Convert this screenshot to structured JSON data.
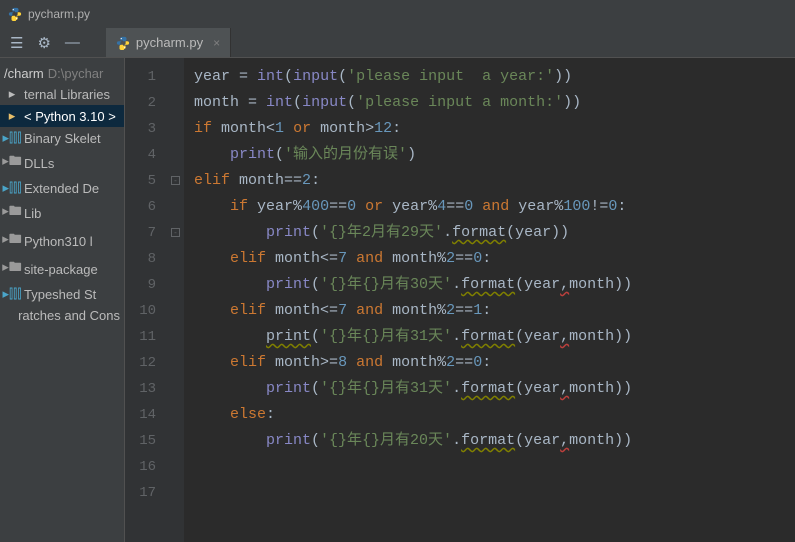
{
  "window": {
    "title": "pycharm.py"
  },
  "tab": {
    "name": "pycharm.py"
  },
  "breadcrumb": {
    "project": "/charm",
    "path": "D:\\pychar"
  },
  "sidebar": {
    "items": [
      {
        "label": "ternal Libraries",
        "icon": "lib"
      },
      {
        "label": "< Python 3.10 >",
        "icon": "py"
      },
      {
        "label": "Binary Skelet",
        "icon": "bars"
      },
      {
        "label": "DLLs",
        "icon": "folder"
      },
      {
        "label": "Extended De",
        "icon": "bars"
      },
      {
        "label": "Lib",
        "icon": "folder"
      },
      {
        "label": "Python310 l",
        "icon": "folder"
      },
      {
        "label": "site-package",
        "icon": "folder"
      },
      {
        "label": "Typeshed St",
        "icon": "bars"
      },
      {
        "label": "ratches and Cons",
        "icon": "none"
      }
    ]
  },
  "code": {
    "line_count": 17,
    "tokens": [
      [
        [
          "id",
          "year "
        ],
        [
          "op",
          "= "
        ],
        [
          "bi",
          "int"
        ],
        [
          "op",
          "("
        ],
        [
          "bi",
          "input"
        ],
        [
          "op",
          "("
        ],
        [
          "str",
          "'please input  a year:'"
        ],
        [
          "op",
          "))"
        ]
      ],
      [
        [
          "id",
          "month "
        ],
        [
          "op",
          "= "
        ],
        [
          "bi",
          "int"
        ],
        [
          "op",
          "("
        ],
        [
          "bi",
          "input"
        ],
        [
          "op",
          "("
        ],
        [
          "str",
          "'please input a month:'"
        ],
        [
          "op",
          "))"
        ]
      ],
      [
        [
          "kw",
          "if "
        ],
        [
          "id",
          "month"
        ],
        [
          "op",
          "<"
        ],
        [
          "num",
          "1"
        ],
        [
          "op",
          " "
        ],
        [
          "kw",
          "or"
        ],
        [
          "op",
          " "
        ],
        [
          "id",
          "month"
        ],
        [
          "op",
          ">"
        ],
        [
          "num",
          "12"
        ],
        [
          "op",
          ":"
        ]
      ],
      [
        [
          "op",
          "    "
        ],
        [
          "fn",
          "print"
        ],
        [
          "op",
          "("
        ],
        [
          "str",
          "'输入的月份有误'"
        ],
        [
          "op",
          ")"
        ]
      ],
      [
        [
          "kw",
          "elif "
        ],
        [
          "id",
          "month"
        ],
        [
          "op",
          "=="
        ],
        [
          "num",
          "2"
        ],
        [
          "op",
          ":"
        ]
      ],
      [
        [
          "op",
          "    "
        ],
        [
          "kw",
          "if "
        ],
        [
          "id",
          "year"
        ],
        [
          "op",
          "%"
        ],
        [
          "num",
          "400"
        ],
        [
          "op",
          "=="
        ],
        [
          "num",
          "0"
        ],
        [
          "op",
          " "
        ],
        [
          "kw",
          "or"
        ],
        [
          "op",
          " "
        ],
        [
          "id",
          "year"
        ],
        [
          "op",
          "%"
        ],
        [
          "num",
          "4"
        ],
        [
          "op",
          "=="
        ],
        [
          "num",
          "0"
        ],
        [
          "op",
          " "
        ],
        [
          "kw",
          "and"
        ],
        [
          "op",
          " "
        ],
        [
          "id",
          "year"
        ],
        [
          "op",
          "%"
        ],
        [
          "num",
          "100"
        ],
        [
          "op",
          "!="
        ],
        [
          "num",
          "0"
        ],
        [
          "op",
          ":"
        ]
      ],
      [
        [
          "op",
          "        "
        ],
        [
          "fn",
          "print"
        ],
        [
          "op",
          "("
        ],
        [
          "str",
          "'{}年2月有29天'"
        ],
        [
          "op",
          "."
        ],
        [
          "id warn",
          "format"
        ],
        [
          "op",
          "(year))"
        ]
      ],
      [
        [
          "op",
          "    "
        ],
        [
          "kw",
          "elif "
        ],
        [
          "id",
          "month"
        ],
        [
          "op",
          "<="
        ],
        [
          "num",
          "7"
        ],
        [
          "op",
          " "
        ],
        [
          "kw",
          "and"
        ],
        [
          "op",
          " "
        ],
        [
          "id",
          "month"
        ],
        [
          "op",
          "%"
        ],
        [
          "num",
          "2"
        ],
        [
          "op",
          "=="
        ],
        [
          "num",
          "0"
        ],
        [
          "op",
          ":"
        ]
      ],
      [
        [
          "op",
          "        "
        ],
        [
          "fn",
          "print"
        ],
        [
          "op",
          "("
        ],
        [
          "str",
          "'{}年{}月有30天'"
        ],
        [
          "op",
          "."
        ],
        [
          "id warn",
          "format"
        ],
        [
          "op",
          "(year"
        ],
        [
          "err",
          ","
        ],
        [
          "op",
          "month))"
        ]
      ],
      [
        [
          "op",
          "    "
        ],
        [
          "kw",
          "elif "
        ],
        [
          "id",
          "month"
        ],
        [
          "op",
          "<="
        ],
        [
          "num",
          "7"
        ],
        [
          "op",
          " "
        ],
        [
          "kw",
          "and"
        ],
        [
          "op",
          " "
        ],
        [
          "id",
          "month"
        ],
        [
          "op",
          "%"
        ],
        [
          "num",
          "2"
        ],
        [
          "op",
          "=="
        ],
        [
          "num",
          "1"
        ],
        [
          "op",
          ":"
        ]
      ],
      [
        [
          "op",
          "        "
        ],
        [
          "warn",
          "print"
        ],
        [
          "op",
          "("
        ],
        [
          "str",
          "'{}年{}月有31天'"
        ],
        [
          "op",
          "."
        ],
        [
          "id warn",
          "format"
        ],
        [
          "op",
          "(year"
        ],
        [
          "err",
          ","
        ],
        [
          "op",
          "month))"
        ]
      ],
      [
        [
          "op",
          "    "
        ],
        [
          "kw",
          "elif "
        ],
        [
          "id",
          "month"
        ],
        [
          "op",
          ">="
        ],
        [
          "num",
          "8"
        ],
        [
          "op",
          " "
        ],
        [
          "kw",
          "and"
        ],
        [
          "op",
          " "
        ],
        [
          "id",
          "month"
        ],
        [
          "op",
          "%"
        ],
        [
          "num",
          "2"
        ],
        [
          "op",
          "=="
        ],
        [
          "num",
          "0"
        ],
        [
          "op",
          ":"
        ]
      ],
      [
        [
          "op",
          "        "
        ],
        [
          "fn",
          "print"
        ],
        [
          "op",
          "("
        ],
        [
          "str",
          "'{}年{}月有31天'"
        ],
        [
          "op",
          "."
        ],
        [
          "id warn",
          "format"
        ],
        [
          "op",
          "(year"
        ],
        [
          "err",
          ","
        ],
        [
          "op",
          "month))"
        ]
      ],
      [
        [
          "op",
          "    "
        ],
        [
          "kw",
          "else"
        ],
        [
          "op",
          ":"
        ]
      ],
      [
        [
          "op",
          "        "
        ],
        [
          "fn",
          "print"
        ],
        [
          "op",
          "("
        ],
        [
          "str",
          "'{}年{}月有20天'"
        ],
        [
          "op",
          "."
        ],
        [
          "id warn",
          "format"
        ],
        [
          "op",
          "(year"
        ],
        [
          "err",
          ","
        ],
        [
          "op",
          "month))"
        ]
      ],
      [],
      []
    ],
    "fold_marks": {
      "5": "-",
      "7": "-"
    }
  }
}
